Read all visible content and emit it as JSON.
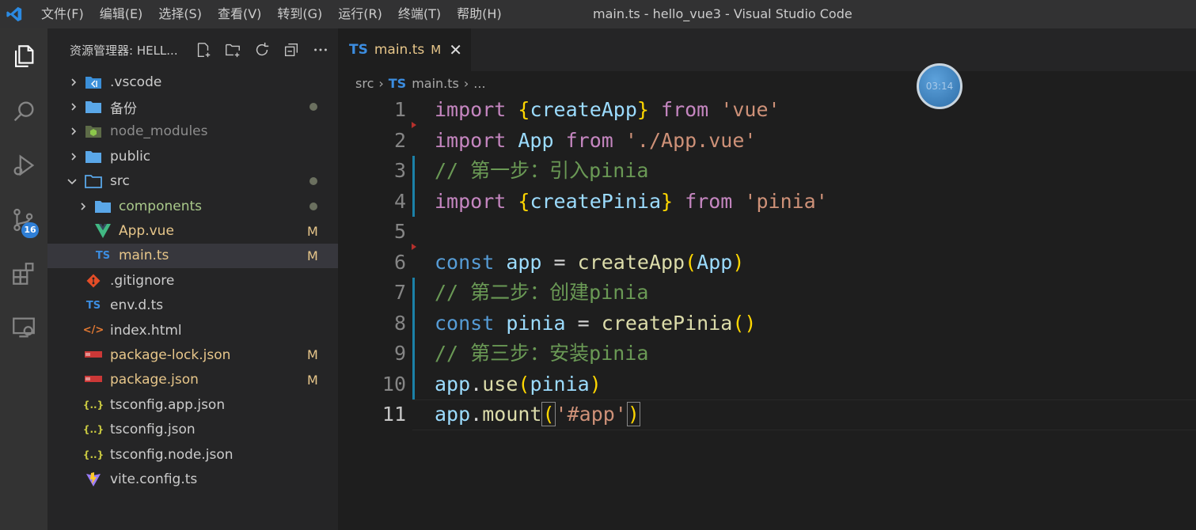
{
  "app": {
    "window_title": "main.ts - hello_vue3 - Visual Studio Code",
    "menu": [
      "文件(F)",
      "编辑(E)",
      "选择(S)",
      "查看(V)",
      "转到(G)",
      "运行(R)",
      "终端(T)",
      "帮助(H)"
    ]
  },
  "activity": {
    "items": [
      "explorer-icon",
      "search-icon",
      "run-debug-icon",
      "source-control-icon",
      "extensions-icon",
      "remote-explorer-icon"
    ],
    "scm_badge": "16"
  },
  "sidebar": {
    "title": "资源管理器: HELL...",
    "actions": [
      "new-file-icon",
      "new-folder-icon",
      "refresh-icon",
      "collapse-all-icon",
      "more-icon"
    ],
    "items": [
      {
        "name": ".vscode",
        "status": "",
        "icon": "vscode-folder-icon"
      },
      {
        "name": "备份",
        "status": "",
        "icon": "folder-icon"
      },
      {
        "name": "node_modules",
        "status": "",
        "icon": "node-folder-icon"
      },
      {
        "name": "public",
        "status": "",
        "icon": "folder-icon"
      },
      {
        "name": "src",
        "status": "",
        "icon": "folder-open-icon"
      },
      {
        "name": "components",
        "status": "",
        "icon": "folder-icon"
      },
      {
        "name": "App.vue",
        "status": "M",
        "icon": "vue-icon"
      },
      {
        "name": "main.ts",
        "status": "M",
        "icon": "typescript-icon"
      },
      {
        "name": ".gitignore",
        "status": "",
        "icon": "git-icon"
      },
      {
        "name": "env.d.ts",
        "status": "",
        "icon": "typescript-icon"
      },
      {
        "name": "index.html",
        "status": "",
        "icon": "html-icon"
      },
      {
        "name": "package-lock.json",
        "status": "M",
        "icon": "npm-icon"
      },
      {
        "name": "package.json",
        "status": "M",
        "icon": "npm-icon"
      },
      {
        "name": "tsconfig.app.json",
        "status": "",
        "icon": "json-icon"
      },
      {
        "name": "tsconfig.json",
        "status": "",
        "icon": "json-icon"
      },
      {
        "name": "tsconfig.node.json",
        "status": "",
        "icon": "json-icon"
      },
      {
        "name": "vite.config.ts",
        "status": "",
        "icon": "vite-icon"
      }
    ]
  },
  "editor": {
    "tab": {
      "lang": "TS",
      "name": "main.ts",
      "modified": "M",
      "close": "✕"
    },
    "breadcrumbs": {
      "folder": "src",
      "lang": "TS",
      "file": "main.ts",
      "more": "..."
    },
    "lines": [
      {
        "no": "1",
        "tokens": [
          [
            "k",
            "import"
          ],
          [
            "pl",
            " "
          ],
          [
            "p1",
            "{"
          ],
          [
            "v",
            "createApp"
          ],
          [
            "p1",
            "}"
          ],
          [
            "pl",
            " "
          ],
          [
            "k",
            "from"
          ],
          [
            "pl",
            " "
          ],
          [
            "s",
            "'vue'"
          ]
        ]
      },
      {
        "no": "2",
        "tokens": [
          [
            "k",
            "import"
          ],
          [
            "pl",
            " "
          ],
          [
            "v",
            "App"
          ],
          [
            "pl",
            " "
          ],
          [
            "k",
            "from"
          ],
          [
            "pl",
            " "
          ],
          [
            "s",
            "'./App.vue'"
          ]
        ]
      },
      {
        "no": "3",
        "tokens": [
          [
            "c",
            "// 第一步：引入pinia"
          ]
        ]
      },
      {
        "no": "4",
        "tokens": [
          [
            "k",
            "import"
          ],
          [
            "pl",
            " "
          ],
          [
            "p1",
            "{"
          ],
          [
            "v",
            "createPinia"
          ],
          [
            "p1",
            "}"
          ],
          [
            "pl",
            " "
          ],
          [
            "k",
            "from"
          ],
          [
            "pl",
            " "
          ],
          [
            "s",
            "'pinia'"
          ]
        ]
      },
      {
        "no": "5",
        "tokens": []
      },
      {
        "no": "6",
        "tokens": [
          [
            "b",
            "const"
          ],
          [
            "pl",
            " "
          ],
          [
            "v",
            "app"
          ],
          [
            "pl",
            " = "
          ],
          [
            "f",
            "createApp"
          ],
          [
            "p1",
            "("
          ],
          [
            "v",
            "App"
          ],
          [
            "p1",
            ")"
          ]
        ]
      },
      {
        "no": "7",
        "tokens": [
          [
            "c",
            "// 第二步：创建pinia"
          ]
        ]
      },
      {
        "no": "8",
        "tokens": [
          [
            "b",
            "const"
          ],
          [
            "pl",
            " "
          ],
          [
            "v",
            "pinia"
          ],
          [
            "pl",
            " = "
          ],
          [
            "f",
            "createPinia"
          ],
          [
            "p1",
            "()"
          ]
        ]
      },
      {
        "no": "9",
        "tokens": [
          [
            "c",
            "// 第三步：安装pinia"
          ]
        ]
      },
      {
        "no": "10",
        "tokens": [
          [
            "v",
            "app"
          ],
          [
            "pl",
            "."
          ],
          [
            "f",
            "use"
          ],
          [
            "p1",
            "("
          ],
          [
            "v",
            "pinia"
          ],
          [
            "p1",
            ")"
          ]
        ]
      },
      {
        "no": "11",
        "tokens": [
          [
            "v",
            "app"
          ],
          [
            "pl",
            "."
          ],
          [
            "f",
            "mount"
          ],
          [
            "p1",
            "("
          ],
          [
            "s",
            "'#app'"
          ],
          [
            "p1",
            ")"
          ]
        ]
      }
    ]
  },
  "overlay": {
    "timer": "03:14"
  },
  "colors": {
    "accent": "#3c8de0",
    "modified": "#e7c68a",
    "comment": "#6a9955",
    "keyword": "#c586c0"
  }
}
